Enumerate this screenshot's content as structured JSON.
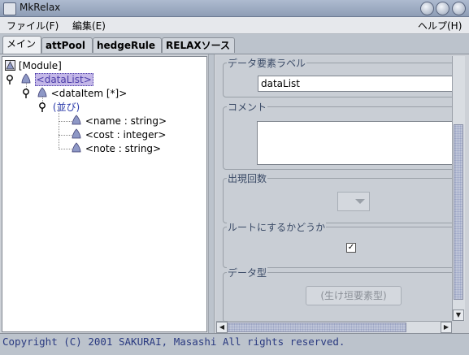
{
  "window": {
    "title": "MkRelax"
  },
  "menubar": {
    "file": "ファイル(F)",
    "edit": "編集(E)",
    "help": "ヘルプ(H)"
  },
  "tabs": [
    {
      "label": "メイン"
    },
    {
      "label": "attPool"
    },
    {
      "label": "hedgeRule"
    },
    {
      "label": "RELAXソース"
    }
  ],
  "tree": {
    "module": "[Module]",
    "dataList": "<dataList>",
    "dataItem": "<dataItem [*]>",
    "sequence": "(並び)",
    "name": "<name : string>",
    "cost": "<cost : integer>",
    "note": "<note : string>"
  },
  "properties": {
    "label_title": "データ要素ラベル",
    "label_value": "dataList",
    "comment_title": "コメント",
    "comment_value": "",
    "occurrence_title": "出現回数",
    "root_title": "ルートにするかどうか",
    "root_checked": "✓",
    "datatype_title": "データ型",
    "datatype_button": "(生け垣要素型)"
  },
  "status": {
    "copyright": "Copyright (C) 2001 SAKURAI, Masashi  All rights reserved."
  },
  "colors": {
    "selection": "#c4b8e8",
    "selection_text": "#4b3ca8",
    "icon": "#8e98c6"
  }
}
